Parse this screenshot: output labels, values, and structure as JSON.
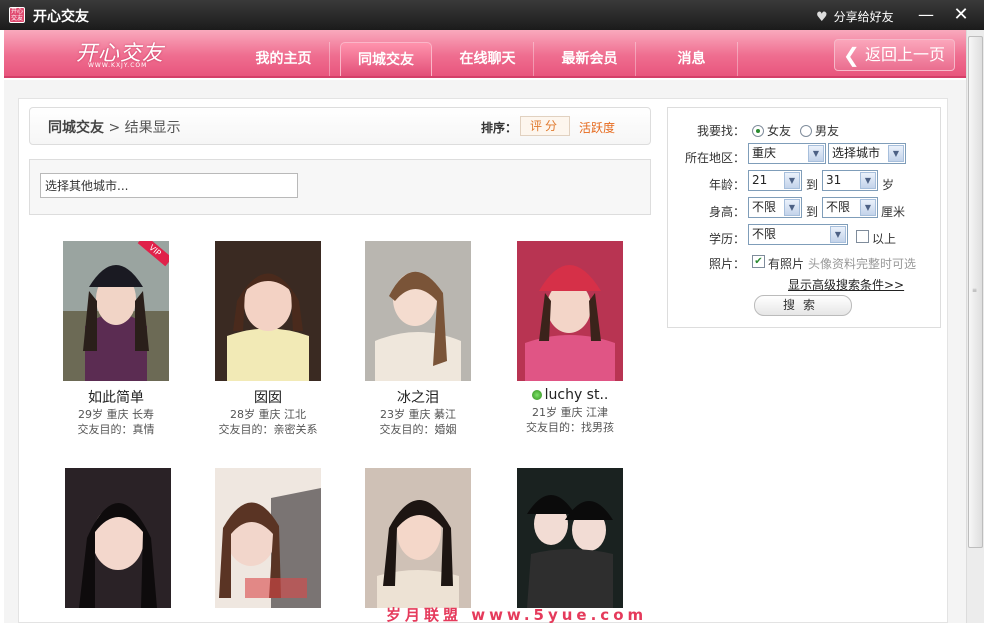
{
  "window": {
    "title": "开心交友",
    "app_icon_text": "开心交友",
    "share_label": "分享给好友",
    "minimize": "—",
    "close": "✕"
  },
  "nav": {
    "logo": "开心交友",
    "logo_sub": "WWW.KXJY.COM",
    "items": [
      {
        "label": "我的主页"
      },
      {
        "label": "同城交友"
      },
      {
        "label": "在线聊天"
      },
      {
        "label": "最新会员"
      },
      {
        "label": "消息"
      }
    ],
    "active_index": 1,
    "back_label": "返回上一页"
  },
  "breadcrumb": {
    "section": "同城交友",
    "separator": ">",
    "page": "结果显示"
  },
  "sort": {
    "label": "排序：",
    "score": "评分",
    "activity": "活跃度"
  },
  "city_select": {
    "placeholder": "选择其他城市..."
  },
  "profiles": [
    {
      "name": "如此简单",
      "info": "29岁 重庆 长寿",
      "purpose": "交友目的：真情",
      "vip": true,
      "vip_text": "VIP",
      "online": false
    },
    {
      "name": "囡囡",
      "info": "28岁 重庆 江北",
      "purpose": "交友目的：亲密关系",
      "vip": false,
      "online": false
    },
    {
      "name": "冰之泪",
      "info": "23岁 重庆 綦江",
      "purpose": "交友目的：婚姻",
      "vip": false,
      "online": false
    },
    {
      "name": "luchy st..",
      "info": "21岁 重庆 江津",
      "purpose": "交友目的：找男孩",
      "vip": false,
      "online": true
    },
    {
      "name": "",
      "info": "",
      "purpose": "",
      "vip": false,
      "online": false
    },
    {
      "name": "",
      "info": "",
      "purpose": "",
      "vip": false,
      "online": false
    },
    {
      "name": "",
      "info": "",
      "purpose": "",
      "vip": false,
      "online": false
    },
    {
      "name": "",
      "info": "",
      "purpose": "",
      "vip": false,
      "online": false
    }
  ],
  "search": {
    "looking_for_label": "我要找：",
    "female": "女友",
    "male": "男友",
    "region_label": "所在地区：",
    "province": "重庆",
    "city": "选择城市",
    "age_label": "年龄：",
    "age_from": "21",
    "age_to": "31",
    "to_word": "到",
    "age_unit": "岁",
    "height_label": "身高：",
    "height_from": "不限",
    "height_to": "不限",
    "height_unit": "厘米",
    "education_label": "学历：",
    "education": "不限",
    "above_label": "以上",
    "photo_label": "照片：",
    "has_photo": "有照片",
    "photo_hint": "头像资料完整时可选",
    "advanced_link": "显示高级搜索条件>>",
    "submit": "搜索"
  },
  "watermark": "岁月联盟 www.5yue.com",
  "colors": {
    "accent": "#e8557d",
    "sort_active": "#e66a1d"
  }
}
